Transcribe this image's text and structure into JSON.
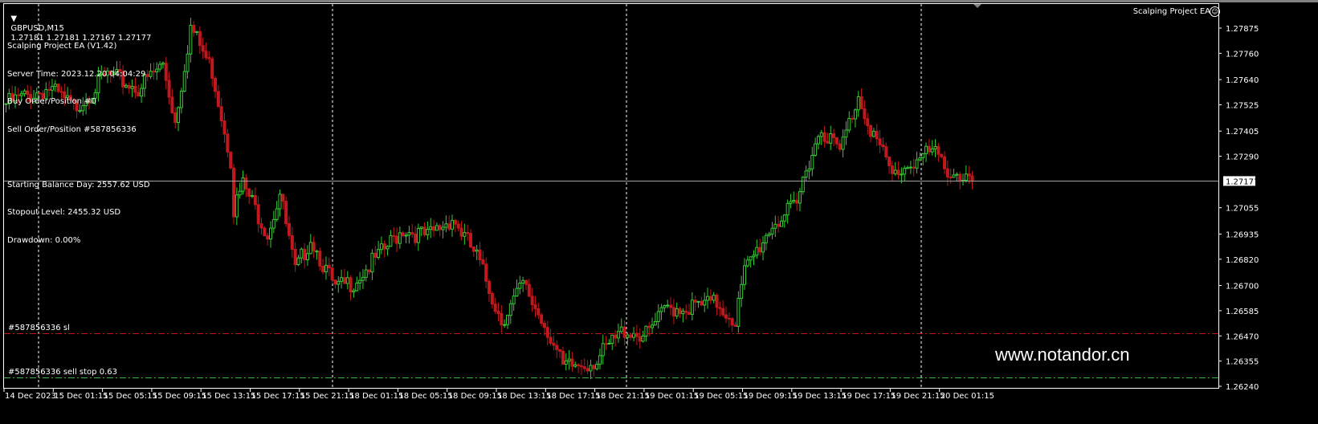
{
  "header": {
    "symbol_timeframe": "GBPUSD,M15",
    "ohlc": "1.27181 1.27181 1.27167 1.27177",
    "ea_name": "Scalping Project EA"
  },
  "info_panel": {
    "lines": [
      "Scalping Project EA (V1.42)",
      "Server Time: 2023.12.20 04:04:29",
      "Buy Order/Position #0",
      "Sell Order/Position #587856336",
      "",
      "Starting Balance Day: 2557.62 USD",
      "Stopout Level: 2455.32 USD",
      "Drawdown: 0.00%"
    ]
  },
  "order_lines": {
    "sl_label": "#587856336 sl",
    "sl_price": 1.26482,
    "sell_stop_label": "#587856336 sell stop 0.63",
    "sell_stop_price": 1.26282
  },
  "current_price": "1.27177",
  "watermark": "www.notandor.cn",
  "colors": {
    "bull": "#32cd32",
    "bear": "#c0181c",
    "sl": "#c0181c",
    "sell_stop": "#3cb43c",
    "grid": "#ffffff",
    "price_line": "#a0a0a0"
  },
  "chart_data": {
    "type": "candlestick",
    "symbol": "GBPUSD",
    "timeframe": "M15",
    "y_ticks": [
      "1.27875",
      "1.27760",
      "1.27640",
      "1.27525",
      "1.27405",
      "1.27290",
      "1.27055",
      "1.26935",
      "1.26820",
      "1.26700",
      "1.26585",
      "1.26470",
      "1.26355",
      "1.26240"
    ],
    "ylim": [
      1.26225,
      1.27925
    ],
    "x_ticks": [
      "14 Dec 2023",
      "15 Dec 01:15",
      "15 Dec 05:15",
      "15 Dec 09:15",
      "15 Dec 13:15",
      "15 Dec 17:15",
      "15 Dec 21:15",
      "18 Dec 01:15",
      "18 Dec 05:15",
      "18 Dec 09:15",
      "18 Dec 13:15",
      "18 Dec 17:15",
      "18 Dec 21:15",
      "19 Dec 01:15",
      "19 Dec 05:15",
      "19 Dec 09:15",
      "19 Dec 13:15",
      "19 Dec 17:15",
      "19 Dec 21:15",
      "20 Dec 01:15"
    ],
    "bars_per_tick": 16,
    "close_keypoints": [
      [
        0,
        1.2753
      ],
      [
        14,
        1.276
      ],
      [
        22,
        1.2751
      ],
      [
        33,
        1.2766
      ],
      [
        43,
        1.276
      ],
      [
        51,
        1.2771
      ],
      [
        55,
        1.2745
      ],
      [
        60,
        1.2788
      ],
      [
        67,
        1.2768
      ],
      [
        73,
        1.2728
      ],
      [
        74,
        1.2705
      ],
      [
        77,
        1.2716
      ],
      [
        85,
        1.2694
      ],
      [
        89,
        1.2712
      ],
      [
        94,
        1.2676
      ],
      [
        99,
        1.2692
      ],
      [
        107,
        1.2668
      ],
      [
        113,
        1.2672
      ],
      [
        121,
        1.2683
      ],
      [
        129,
        1.2696
      ],
      [
        137,
        1.2692
      ],
      [
        145,
        1.2701
      ],
      [
        153,
        1.2683
      ],
      [
        161,
        1.2654
      ],
      [
        168,
        1.267
      ],
      [
        176,
        1.265
      ],
      [
        181,
        1.2632
      ],
      [
        192,
        1.2636
      ],
      [
        201,
        1.265
      ],
      [
        208,
        1.2647
      ],
      [
        215,
        1.266
      ],
      [
        223,
        1.266
      ],
      [
        231,
        1.2662
      ],
      [
        237,
        1.2654
      ],
      [
        240,
        1.2676
      ],
      [
        249,
        1.2698
      ],
      [
        257,
        1.2706
      ],
      [
        260,
        1.2724
      ],
      [
        265,
        1.2742
      ],
      [
        271,
        1.2731
      ],
      [
        277,
        1.2757
      ],
      [
        281,
        1.2742
      ],
      [
        288,
        1.272
      ],
      [
        294,
        1.2726
      ],
      [
        301,
        1.2731
      ],
      [
        306,
        1.2723
      ],
      [
        314,
        1.27177
      ]
    ]
  }
}
